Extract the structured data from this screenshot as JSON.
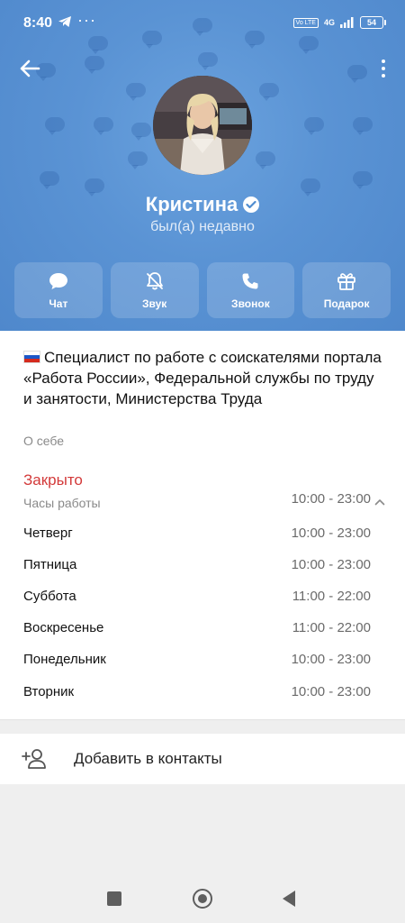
{
  "status_bar": {
    "time": "8:40",
    "dots": "···",
    "vo_tag": "Vo LTE",
    "network": "4G",
    "battery": "54"
  },
  "profile": {
    "name": "Кристина",
    "status": "был(а) недавно",
    "verified": true,
    "accent_color": "#5a93d4"
  },
  "actions": [
    {
      "label": "Чат",
      "icon": "chat-icon"
    },
    {
      "label": "Звук",
      "icon": "bell-off-icon"
    },
    {
      "label": "Звонок",
      "icon": "phone-icon"
    },
    {
      "label": "Подарок",
      "icon": "gift-icon"
    }
  ],
  "bio": {
    "text": "Специалист по работе с соискателями портала «Работа России», Федеральной службы по труду и занятости, Министерства Труда",
    "flag": "russia-flag-icon",
    "caption": "О себе"
  },
  "business_hours": {
    "status": "Закрыто",
    "status_color": "#d33a3a",
    "label": "Часы работы",
    "today": "10:00 - 23:00",
    "days": [
      {
        "day": "Четверг",
        "hours": "10:00 - 23:00"
      },
      {
        "day": "Пятница",
        "hours": "10:00 - 23:00"
      },
      {
        "day": "Суббота",
        "hours": "11:00 - 22:00"
      },
      {
        "day": "Воскресенье",
        "hours": "11:00 - 22:00"
      },
      {
        "day": "Понедельник",
        "hours": "10:00 - 23:00"
      },
      {
        "day": "Вторник",
        "hours": "10:00 - 23:00"
      }
    ]
  },
  "add_contact": {
    "label": "Добавить в контакты"
  }
}
